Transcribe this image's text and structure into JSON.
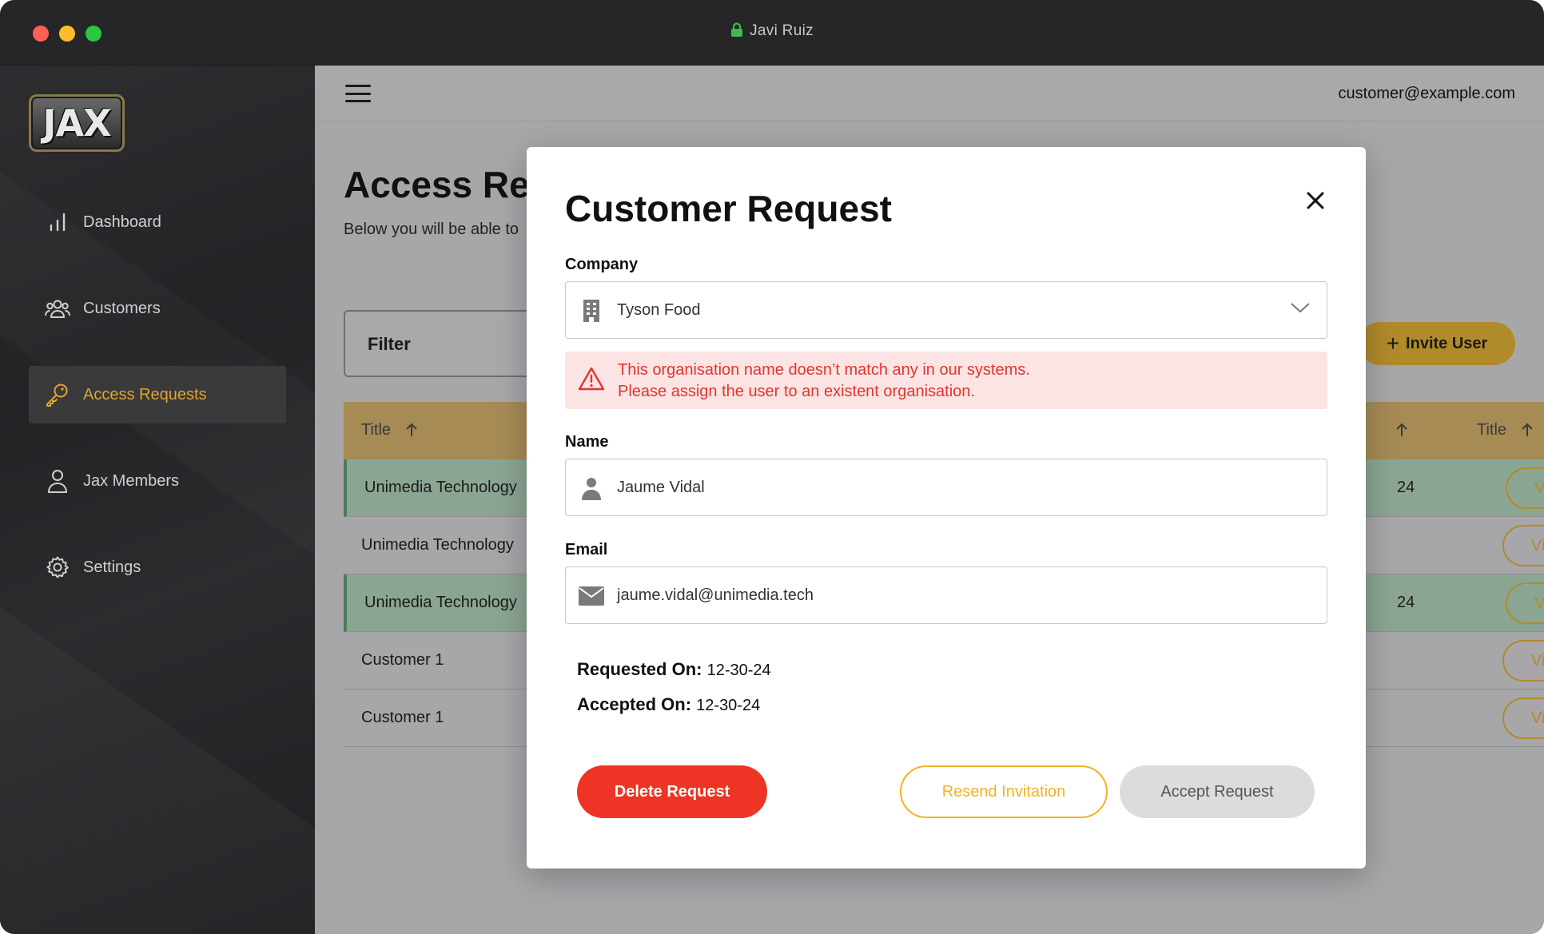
{
  "window": {
    "title": "Javi Ruiz"
  },
  "sidebar": {
    "logo_text": "JAX",
    "items": [
      {
        "label": "Dashboard",
        "icon": "bar-chart-icon",
        "active": false
      },
      {
        "label": "Customers",
        "icon": "users-icon",
        "active": false
      },
      {
        "label": "Access Requests",
        "icon": "key-icon",
        "active": true
      },
      {
        "label": "Jax Members",
        "icon": "user-icon",
        "active": false
      },
      {
        "label": "Settings",
        "icon": "gear-icon",
        "active": false
      }
    ]
  },
  "header": {
    "user_email": "customer@example.com"
  },
  "page": {
    "title": "Access Re",
    "subtitle": "Below you will be able to",
    "filter_label": "Filter",
    "invite_button": "Invite User"
  },
  "table": {
    "columns": [
      "Title",
      "Title"
    ],
    "rows": [
      {
        "title": "Unimedia Technology",
        "date": "24",
        "action": "View",
        "highlighted": true
      },
      {
        "title": "Unimedia Technology",
        "date": "",
        "action": "View",
        "highlighted": false
      },
      {
        "title": "Unimedia Technology",
        "date": "24",
        "action": "View",
        "highlighted": true
      },
      {
        "title": "Customer 1",
        "date": "",
        "action": "View",
        "highlighted": false
      },
      {
        "title": "Customer 1",
        "date": "",
        "action": "View",
        "highlighted": false
      }
    ]
  },
  "modal": {
    "title": "Customer Request",
    "company": {
      "label": "Company",
      "value": "Tyson Food"
    },
    "alert": {
      "line1": "This organisation name doesn’t match any in our systems.",
      "line2": "Please assign the user to an existent organisation."
    },
    "name": {
      "label": "Name",
      "value": "Jaume Vidal"
    },
    "email": {
      "label": "Email",
      "value": "jaume.vidal@unimedia.tech"
    },
    "requested_on": {
      "label": "Requested On:",
      "value": "12-30-24"
    },
    "accepted_on": {
      "label": "Accepted On:",
      "value": "12-30-24"
    },
    "buttons": {
      "delete": "Delete Request",
      "resend": "Resend Invitation",
      "accept": "Accept Request"
    }
  },
  "colors": {
    "accent": "#e0a52e",
    "danger": "#ee3424",
    "resend": "#f2b324",
    "highlight_row": "#8ba593"
  }
}
